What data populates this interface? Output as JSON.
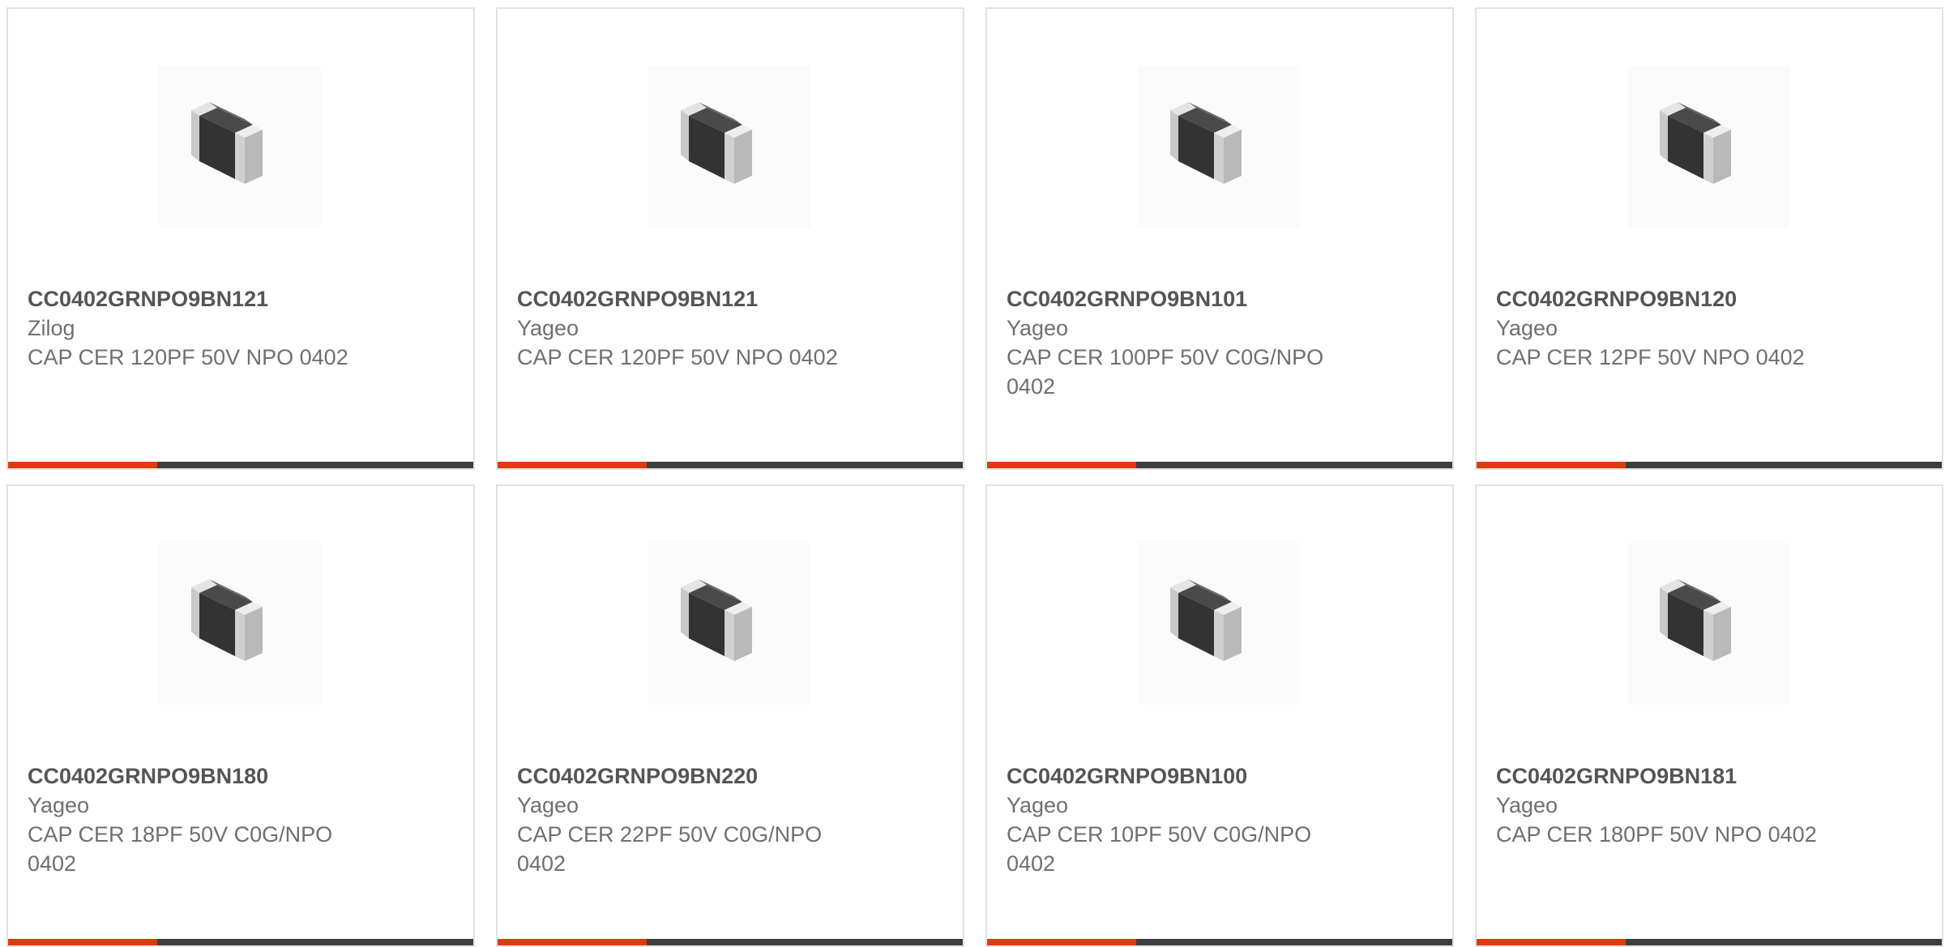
{
  "theme": {
    "accent": "#e03a0c",
    "bar_track": "#3d3d3d",
    "border": "#e2e2e2",
    "text_primary": "#555555",
    "text_secondary": "#6f6f6f"
  },
  "products": [
    {
      "part_number": "CC0402GRNPO9BN121",
      "manufacturer": "Zilog",
      "description": "CAP CER 120PF 50V NPO 0402",
      "image_icon": "capacitor-chip-icon",
      "bar_progress": 0.32
    },
    {
      "part_number": "CC0402GRNPO9BN121",
      "manufacturer": "Yageo",
      "description": "CAP CER 120PF 50V NPO 0402",
      "image_icon": "capacitor-chip-icon",
      "bar_progress": 0.32
    },
    {
      "part_number": "CC0402GRNPO9BN101",
      "manufacturer": "Yageo",
      "description": "CAP CER 100PF 50V C0G/NPO 0402",
      "image_icon": "capacitor-chip-icon",
      "bar_progress": 0.32
    },
    {
      "part_number": "CC0402GRNPO9BN120",
      "manufacturer": "Yageo",
      "description": "CAP CER 12PF 50V NPO 0402",
      "image_icon": "capacitor-chip-icon",
      "bar_progress": 0.32
    },
    {
      "part_number": "CC0402GRNPO9BN180",
      "manufacturer": "Yageo",
      "description": "CAP CER 18PF 50V C0G/NPO 0402",
      "image_icon": "capacitor-chip-icon",
      "bar_progress": 0.32
    },
    {
      "part_number": "CC0402GRNPO9BN220",
      "manufacturer": "Yageo",
      "description": "CAP CER 22PF 50V C0G/NPO 0402",
      "image_icon": "capacitor-chip-icon",
      "bar_progress": 0.32
    },
    {
      "part_number": "CC0402GRNPO9BN100",
      "manufacturer": "Yageo",
      "description": "CAP CER 10PF 50V C0G/NPO 0402",
      "image_icon": "capacitor-chip-icon",
      "bar_progress": 0.32
    },
    {
      "part_number": "CC0402GRNPO9BN181",
      "manufacturer": "Yageo",
      "description": "CAP CER 180PF 50V NPO 0402",
      "image_icon": "capacitor-chip-icon",
      "bar_progress": 0.32
    }
  ]
}
